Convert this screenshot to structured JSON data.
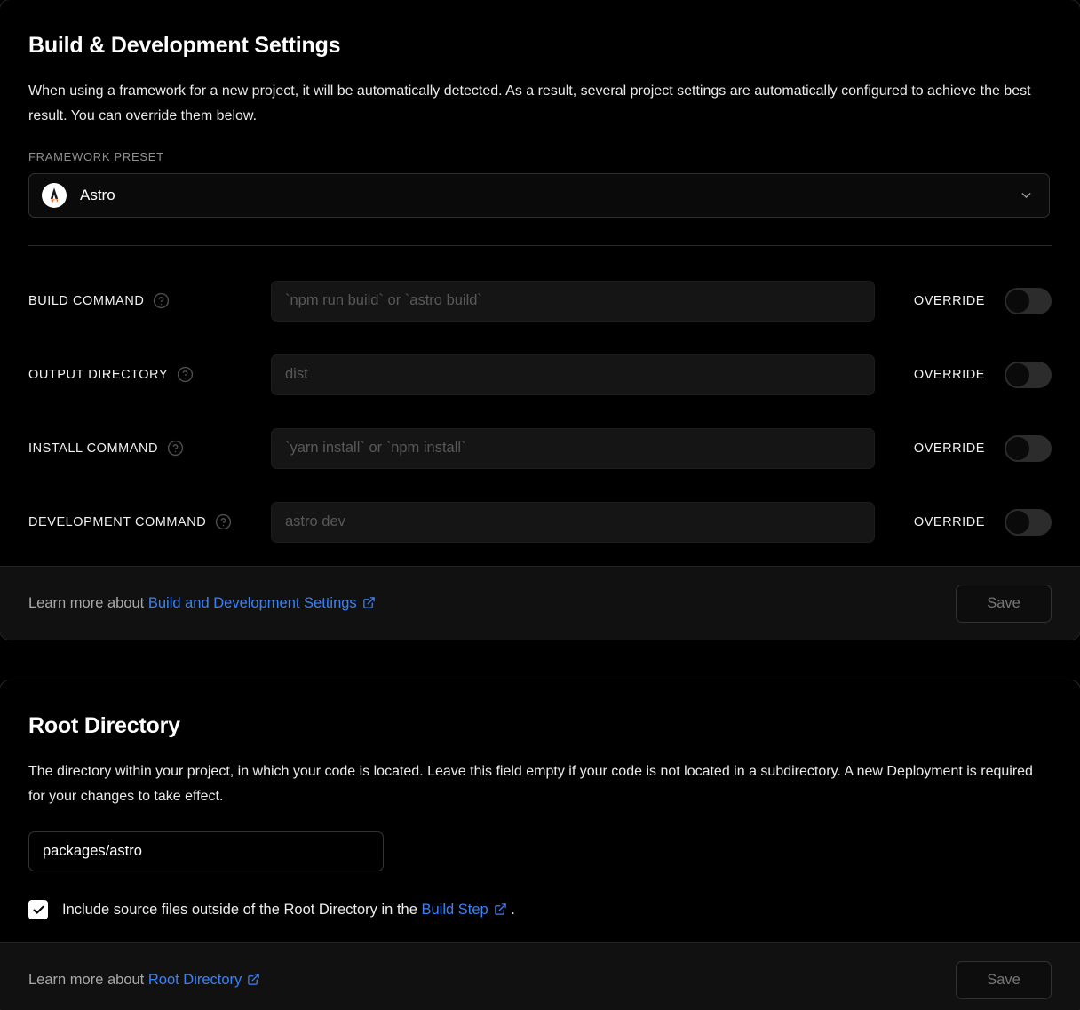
{
  "build_card": {
    "title": "Build & Development Settings",
    "description": "When using a framework for a new project, it will be automatically detected. As a result, several project settings are automatically configured to achieve the best result. You can override them below.",
    "framework_preset": {
      "label": "Framework Preset",
      "value": "Astro",
      "logo_icon": "astro-logo-icon",
      "chevron_icon": "chevron-down-icon"
    },
    "rows": [
      {
        "label": "Build Command",
        "help_icon": "help-circle-icon",
        "placeholder": "`npm run build` or `astro build`",
        "value": "",
        "override_label": "Override",
        "override_on": false
      },
      {
        "label": "Output Directory",
        "help_icon": "help-circle-icon",
        "placeholder": "dist",
        "value": "",
        "override_label": "Override",
        "override_on": false
      },
      {
        "label": "Install Command",
        "help_icon": "help-circle-icon",
        "placeholder": "`yarn install` or `npm install`",
        "value": "",
        "override_label": "Override",
        "override_on": false
      },
      {
        "label": "Development Command",
        "help_icon": "help-circle-icon",
        "placeholder": "astro dev",
        "value": "",
        "override_label": "Override",
        "override_on": false
      }
    ],
    "footer": {
      "prefix": "Learn more about",
      "link_text": "Build and Development Settings",
      "link_icon": "external-link-icon",
      "suffix": "",
      "save_label": "Save",
      "save_disabled": true
    }
  },
  "root_card": {
    "title": "Root Directory",
    "description": "The directory within your project, in which your code is located. Leave this field empty if your code is not located in a subdirectory. A new Deployment is required for your changes to take effect.",
    "input": {
      "value": "packages/astro",
      "placeholder": ""
    },
    "checkbox": {
      "checked": true,
      "check_icon": "checkmark-icon",
      "text_before": "Include source files outside of the Root Directory in the",
      "link_text": "Build Step",
      "link_icon": "external-link-icon",
      "text_after": "."
    },
    "footer": {
      "prefix": "Learn more about",
      "link_text": "Root Directory",
      "link_icon": "external-link-icon",
      "save_label": "Save",
      "save_disabled": true
    }
  },
  "colors": {
    "background": "#000000",
    "card_border": "#252525",
    "footer_background": "#111111",
    "link": "#3b82f6",
    "muted_text": "#8f8f8f",
    "placeholder": "#585858",
    "toggle_track": "#2c2c2c",
    "astro_accent": "#ff5d01"
  }
}
